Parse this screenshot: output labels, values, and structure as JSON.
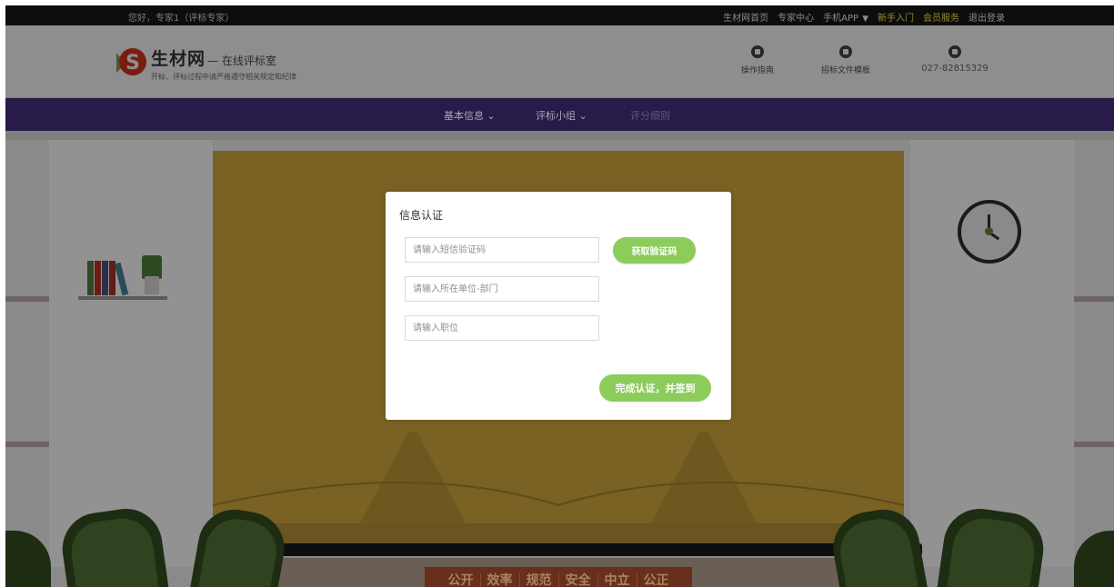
{
  "topbar": {
    "greeting": "您好，专家1（评标专家）",
    "links": [
      {
        "label": "生材网首页",
        "highlight": false
      },
      {
        "label": "专家中心",
        "highlight": false
      },
      {
        "label": "手机APP",
        "highlight": false
      },
      {
        "label": "新手入门",
        "highlight": true
      },
      {
        "label": "会员服务",
        "highlight": true
      },
      {
        "label": "退出登录",
        "highlight": false
      }
    ]
  },
  "header": {
    "brand_name": "生材网",
    "brand_sub": "— 在线评标室",
    "slogan": "开标、评标过程中请严格遵守相关规定和纪律",
    "buttons": [
      {
        "label": "操作指南",
        "icon": "compass-icon"
      },
      {
        "label": "招标文件模板",
        "icon": "document-icon"
      },
      {
        "label": "027-82815329",
        "icon": "phone-icon"
      }
    ]
  },
  "nav": {
    "items": [
      {
        "label": "基本信息",
        "has_dropdown": true
      },
      {
        "label": "评标小组",
        "has_dropdown": true
      },
      {
        "label": "评分细则",
        "has_dropdown": false
      }
    ]
  },
  "scene": {
    "motto": [
      "公开",
      "效率",
      "规范",
      "安全",
      "中立",
      "公正"
    ]
  },
  "dialog": {
    "title": "信息认证",
    "sms_placeholder": "请输入短信验证码",
    "get_code_label": "获取验证码",
    "unit_placeholder": "请输入所在单位-部门",
    "position_placeholder": "请输入职位",
    "submit_label": "完成认证，并签到"
  },
  "colors": {
    "accent_green": "#8ccc5a",
    "nav_purple": "#281b4a",
    "overlay_dim": "#000000"
  }
}
